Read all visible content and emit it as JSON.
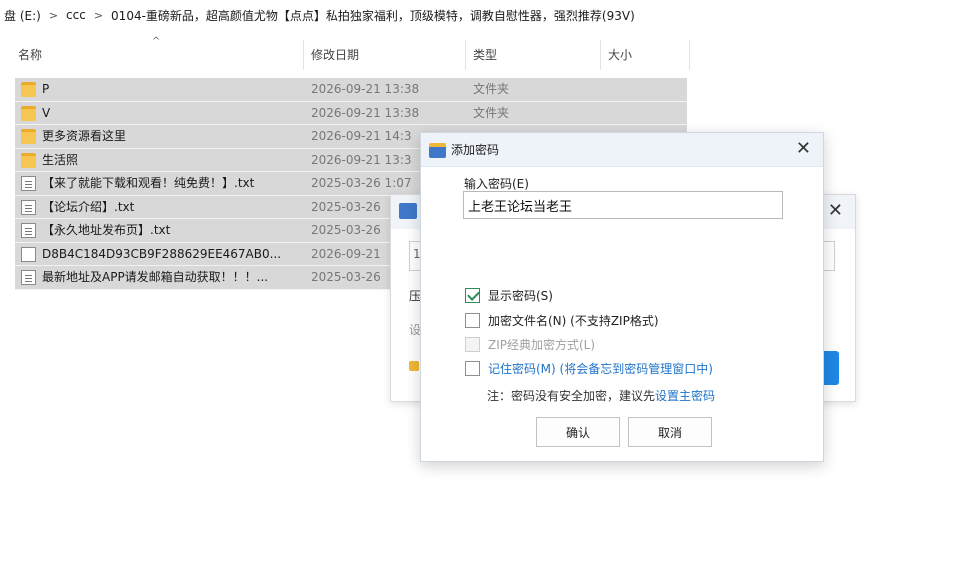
{
  "breadcrumb": {
    "items": [
      "盘 (E:)",
      "ccc",
      "0104-重磅新品，超高颜值尤物【点点】私拍独家福利，顶级模特，调教自慰性器，强烈推荐(93V)"
    ]
  },
  "columns": {
    "name": "名称",
    "date": "修改日期",
    "type": "类型",
    "size": "大小"
  },
  "files": [
    {
      "name": "P",
      "date": "2026-09-21 13:38",
      "type": "文件夹",
      "icon": "folder-icon"
    },
    {
      "name": "V",
      "date": "2026-09-21 13:38",
      "type": "文件夹",
      "icon": "folder-icon"
    },
    {
      "name": "更多资源看这里",
      "date": "2026-09-21 14:3",
      "type": "",
      "icon": "folder-icon"
    },
    {
      "name": "生活照",
      "date": "2026-09-21 13:3",
      "type": "",
      "icon": "folder-icon"
    },
    {
      "name": "【来了就能下载和观看！纯免费！】.txt",
      "date": "2025-03-26 1:07",
      "type": "",
      "icon": "txt-file-icon"
    },
    {
      "name": "【论坛介绍】.txt",
      "date": "2025-03-26",
      "type": "",
      "icon": "txt-file-icon"
    },
    {
      "name": "【永久地址发布页】.txt",
      "date": "2025-03-26",
      "type": "",
      "icon": "txt-file-icon"
    },
    {
      "name": "D8B4C184D93CB9F288629EE467AB0...",
      "date": "2026-09-21",
      "type": "",
      "icon": "blank-file-icon"
    },
    {
      "name": "最新地址及APP请发邮箱自动获取！！！...",
      "date": "2025-03-26",
      "type": "",
      "icon": "txt-file-icon"
    }
  ],
  "bg_dialog": {
    "fragments": [
      "压",
      "设",
      "1"
    ]
  },
  "dialog": {
    "title": "添加密码",
    "password_label": "输入密码(E)",
    "password_value": "上老王论坛当老王",
    "options": {
      "show_password": {
        "label": "显示密码(S)",
        "checked": true
      },
      "encrypt_filenames": {
        "label": "加密文件名(N) (不支持ZIP格式)",
        "checked": false
      },
      "zip_legacy": {
        "label": "ZIP经典加密方式(L)",
        "checked": false,
        "disabled": true
      },
      "remember_password": {
        "label": "记住密码(M) (将会备忘到密码管理窗口中)",
        "checked": false
      }
    },
    "note_prefix": "注：密码没有安全加密，建议先",
    "note_link": "设置主密码",
    "ok_label": "确认",
    "cancel_label": "取消"
  },
  "colors": {
    "selection": "#d8d8d8",
    "link": "#1e73c8",
    "check": "#2e8b57",
    "titlebar": "#eef3f9"
  }
}
